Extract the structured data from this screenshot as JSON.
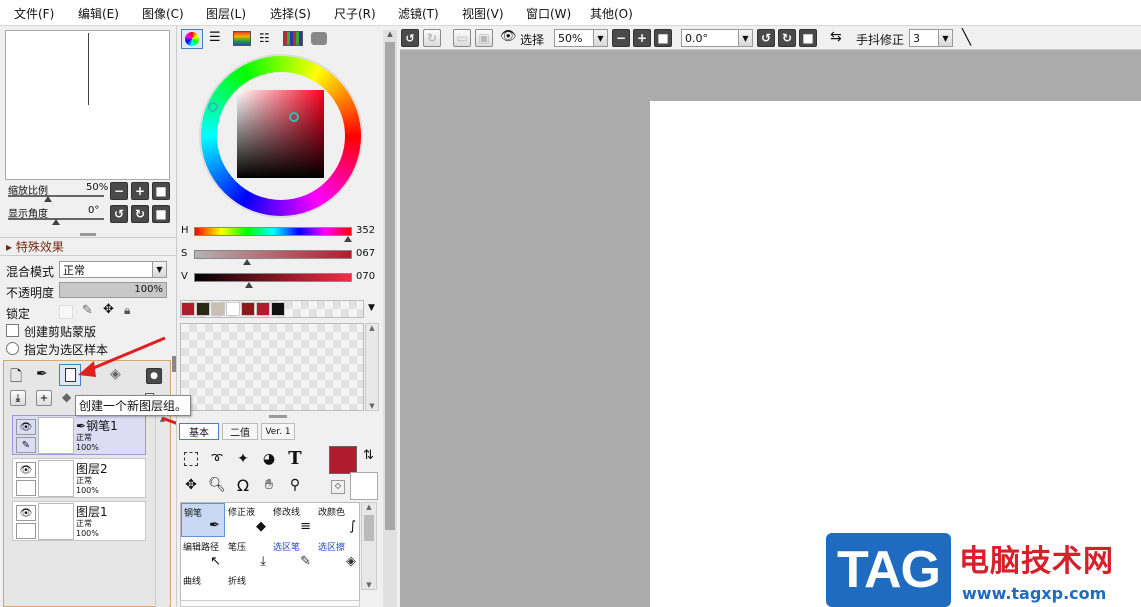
{
  "menu": [
    "文件(F)",
    "编辑(E)",
    "图像(C)",
    "图层(L)",
    "选择(S)",
    "尺子(R)",
    "滤镜(T)",
    "视图(V)",
    "窗口(W)",
    "其他(O)"
  ],
  "navigator": {
    "zoom_label": "缩放比例",
    "zoom_value": "50%",
    "angle_label": "显示角度",
    "angle_value": "0°"
  },
  "effects": {
    "title": "特殊效果"
  },
  "layer_props": {
    "blend_label": "混合模式",
    "blend_value": "正常",
    "opacity_label": "不透明度",
    "opacity_value": "100%",
    "opacity_level": 1.0,
    "lock_label": "锁定",
    "clip_label": "创建剪贴蒙版",
    "selection_label": "指定为选区样本"
  },
  "tooltip": "创建一个新图层组。",
  "layers": [
    {
      "name": "钢笔1",
      "mode": "正常",
      "opacity": "100%",
      "selected": true
    },
    {
      "name": "图层2",
      "mode": "正常",
      "opacity": "100%",
      "selected": false
    },
    {
      "name": "图层1",
      "mode": "正常",
      "opacity": "100%",
      "selected": false
    }
  ],
  "color": {
    "h_label": "H",
    "h_value": "352",
    "s_label": "S",
    "s_value": "067",
    "v_label": "V",
    "v_value": "070",
    "current": "#b01c2e",
    "swatches": [
      "#b01c2e",
      "#2a2a14",
      "#c8bfb4",
      "#ffffff",
      "#8b1a1a",
      "#b01c2e",
      "#111111"
    ]
  },
  "tools": {
    "tabs": [
      "基本",
      "二值",
      "Ver. 1"
    ],
    "brushes": [
      {
        "label": "钢笔"
      },
      {
        "label": "修正液"
      },
      {
        "label": "修改线"
      },
      {
        "label": "改颜色"
      },
      {
        "label": "编辑路径"
      },
      {
        "label": "笔压"
      },
      {
        "label": "选区笔"
      },
      {
        "label": "选区擦"
      },
      {
        "label": "曲线"
      },
      {
        "label": "折线"
      }
    ]
  },
  "toolbar": {
    "select_label": "选择",
    "zoom": "50%",
    "angle": "0.0°",
    "stabilizer_label": "手抖修正",
    "stabilizer_value": "3"
  },
  "watermark": {
    "logo": "TAG",
    "title": "电脑技术网",
    "url": "www.tagxp.com"
  }
}
